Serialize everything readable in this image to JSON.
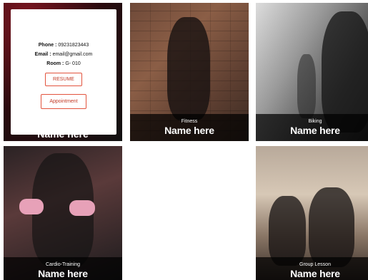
{
  "tiles": [
    {
      "id": "t1",
      "name": "Name here",
      "card": {
        "phone_label": "Phone :",
        "phone_value": "09231823443",
        "email_label": "Email :",
        "email_value": "email@gmail.com",
        "room_label": "Room :",
        "room_value": "G- 010",
        "resume_button": "RESUME",
        "appointment_button": "Appointment"
      }
    },
    {
      "id": "t2",
      "category": "Fitness",
      "name": "Name here"
    },
    {
      "id": "t3",
      "category": "Biking",
      "name": "Name here"
    },
    {
      "id": "t4",
      "category": "Cardio-Training",
      "name": "Name here"
    },
    {
      "id": "t5",
      "category": "Group Lesson",
      "name": "Name here"
    }
  ],
  "colors": {
    "accent": "#e2533d",
    "overlay": "#000000",
    "card": "#ffffff"
  }
}
